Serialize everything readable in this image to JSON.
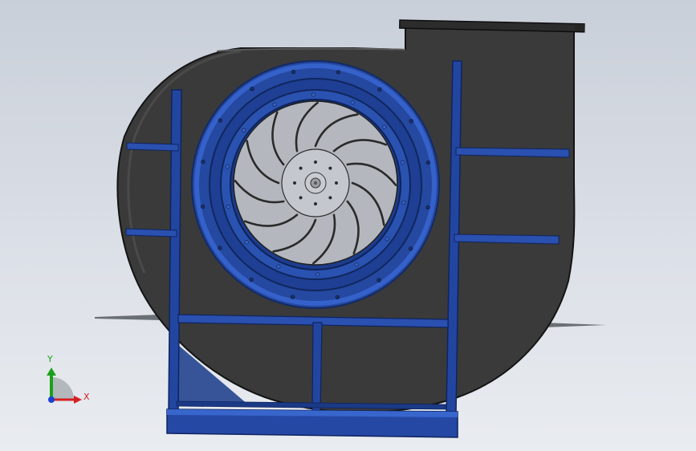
{
  "model": {
    "name": "centrifugal-fan-assembly",
    "colors": {
      "background_top": "#c9cfd9",
      "background_bottom": "#e9ecf0",
      "housing": "#3b3b3b",
      "housing_edge": "#1a1a1a",
      "frame": "#1f3e86",
      "frame_highlight": "#3560c8",
      "ring": "#2d55b8",
      "ring_dark": "#173577",
      "impeller": "#b4b8be",
      "blade": "#2a2a2a",
      "shadow": "#5a5f66"
    },
    "impeller": {
      "blade_count": 12
    },
    "ring_bolts": {
      "count": 16
    },
    "inner_bolts": {
      "count": 14
    },
    "hub_bolts": {
      "count": 8
    }
  },
  "triad": {
    "x_label": "X",
    "y_label": "Y",
    "x_color": "#d42020",
    "y_color": "#1aa01a",
    "z_color": "#1a3fd4"
  }
}
